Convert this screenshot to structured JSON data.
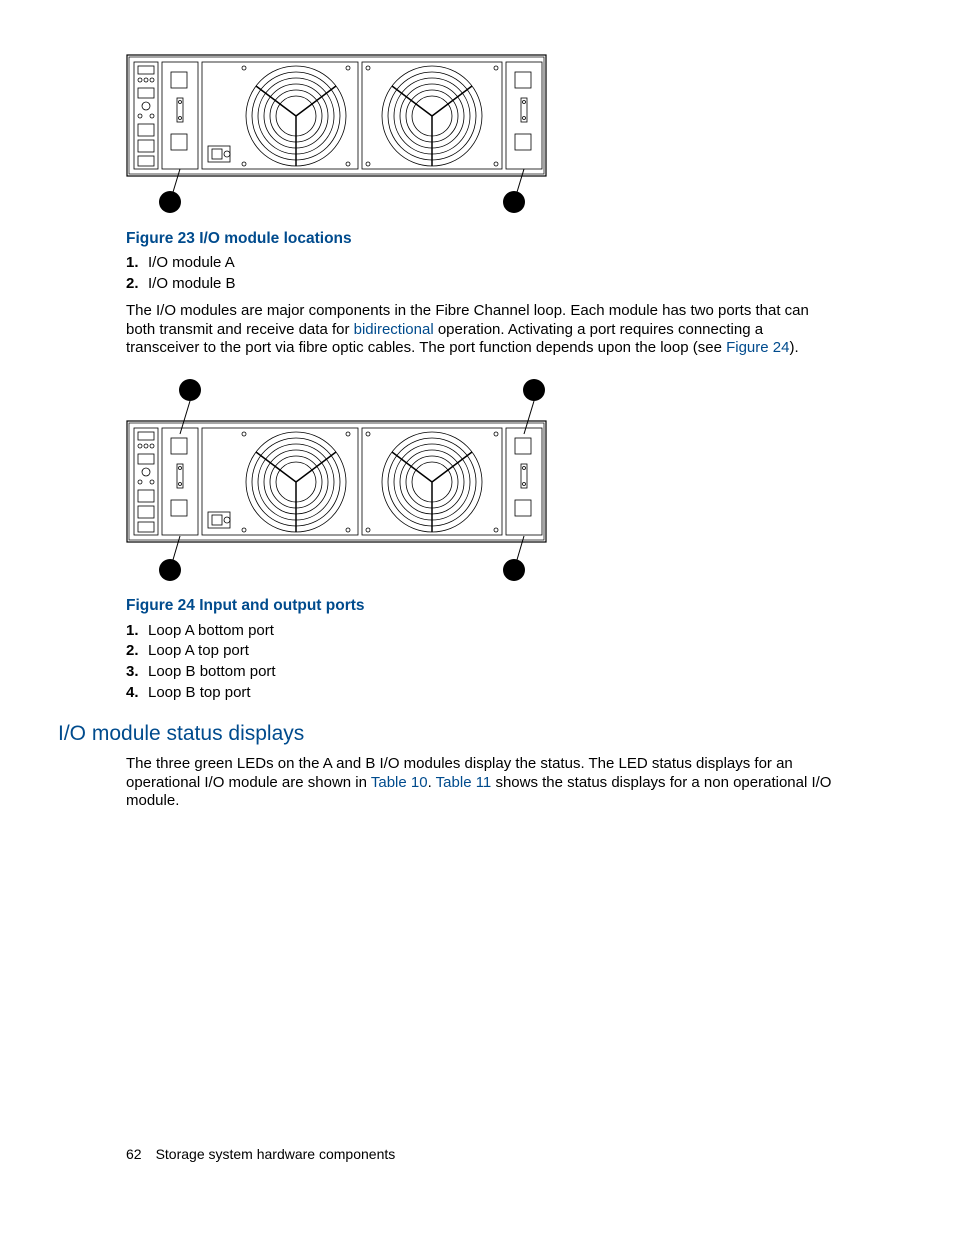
{
  "figure23": {
    "caption": "Figure 23 I/O module locations",
    "items": [
      "I/O module A",
      "I/O module B"
    ]
  },
  "paragraph1": {
    "part1": "The I/O modules are major components in the Fibre Channel loop. Each module has two ports that can both transmit and receive data for ",
    "link1": "bidirectional",
    "part2": " operation. Activating a port requires connecting a transceiver to the port via fibre optic cables. The port function depends upon the loop (see ",
    "link2": "Figure 24",
    "part3": ")."
  },
  "figure24": {
    "caption": "Figure 24 Input and output ports",
    "items": [
      "Loop A bottom port",
      "Loop A top port",
      "Loop B bottom port",
      "Loop B top port"
    ]
  },
  "section_heading": "I/O module status displays",
  "paragraph2": {
    "part1": "The three green LEDs on the A and B I/O modules display the status. The LED status displays for an operational I/O module are shown in ",
    "link1": "Table 10",
    "part2": ". ",
    "link2": "Table 11",
    "part3": " shows the status displays for a non operational I/O module."
  },
  "footer": {
    "page": "62",
    "title": "Storage system hardware components"
  }
}
